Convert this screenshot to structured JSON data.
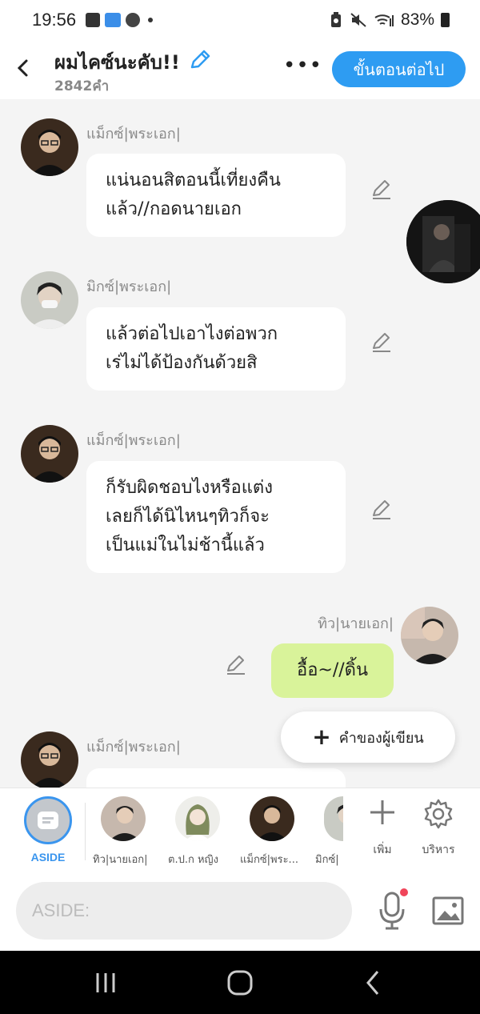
{
  "status_bar": {
    "time": "19:56",
    "battery": "83%",
    "icons": [
      "gallery-icon",
      "webtoon-app-icon",
      "line-app-icon",
      "notification-dot-icon",
      "battery-saver-icon",
      "mute-icon",
      "wifi-icon",
      "signal-icon",
      "battery-icon"
    ]
  },
  "header": {
    "title": "ผมไคซ์นะคับ!!",
    "word_count": "2842คำ",
    "more": "•••",
    "next_button": "ขั้นตอนต่อไป",
    "colors": {
      "accent": "#2e9cf2"
    }
  },
  "messages": [
    {
      "sender": "แม็กซ์|พระเอก|",
      "lines": [
        "แน่นอนสิตอนนี้เที่ยงคืน",
        "แล้ว//กอดนายเอก"
      ],
      "side": "left"
    },
    {
      "sender": "มิกซ์|พระเอก|",
      "lines": [
        "แล้วต่อไปเอาไงต่อพวก",
        "เร่ไม่ได้ป้องกันด้วยสิ"
      ],
      "side": "left"
    },
    {
      "sender": "แม็กซ์|พระเอก|",
      "lines": [
        "ก็รับผิดชอบไงหรือแต่ง",
        "เลยก็ได้นิไหนๆทิวก็จะ",
        "เป็นแม่ในไม่ช้านี้แล้ว"
      ],
      "side": "left"
    },
    {
      "sender": "ทิว|นายเอก|",
      "lines": [
        "อื้อ~//ดิ้น"
      ],
      "side": "right"
    },
    {
      "sender": "แม็กซ์|พระเอก|",
      "lines": [
        ""
      ],
      "side": "left"
    }
  ],
  "writer_note_button": "คำของผู้เขียน",
  "character_bar": {
    "aside_label": "ASIDE",
    "characters": [
      "ทิว|นายเอก|",
      "ต.ป.ก หญิง",
      "แม็กซ์|พระ...",
      "มิกซ์|"
    ],
    "add_label": "เพิ่ม",
    "manage_label": "บริหาร"
  },
  "composer": {
    "placeholder": "ASIDE:"
  },
  "colors": {
    "accent": "#2e9cf2",
    "own_bubble": "#d9f39a",
    "background": "#f4f4f4",
    "notification": "#f0455a"
  }
}
